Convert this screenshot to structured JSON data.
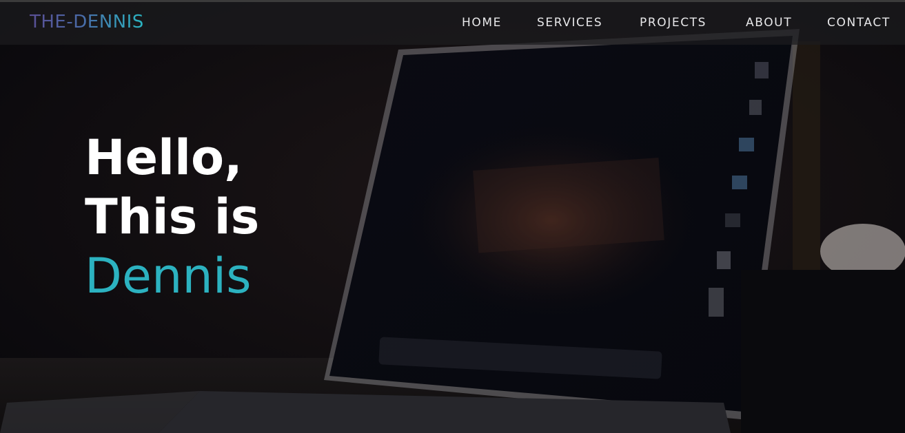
{
  "brand": {
    "logo": "THE-DENNIS"
  },
  "nav": {
    "home": "HOME",
    "services": "SERVICES",
    "projects": "PROJECTS",
    "about": "ABOUT",
    "contact": "CONTACT"
  },
  "hero": {
    "line1": "Hello,",
    "line2": "This is",
    "line3": "Dennis",
    "background_image": "laptop-on-desk-photo"
  },
  "colors": {
    "accent": "#2cb2c0",
    "background": "#0b0b10",
    "nav_text": "#e8e8ea",
    "logo_gradient_start": "#5a4f95",
    "logo_gradient_end": "#2ab6c2"
  }
}
